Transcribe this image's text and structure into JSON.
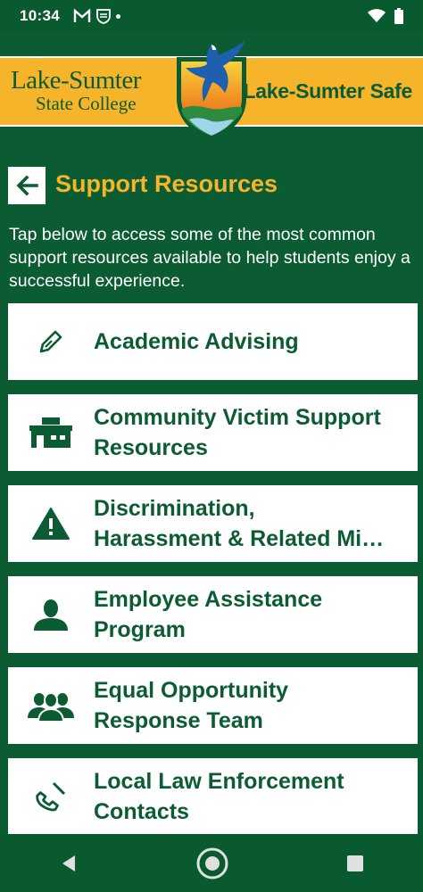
{
  "status_bar": {
    "time": "10:34"
  },
  "header": {
    "logo_line1": "Lake-Sumter",
    "logo_line2": "State College",
    "app_title": "Lake-Sumter Safe"
  },
  "page": {
    "title": "Support Resources",
    "intro": "Tap below to access some of the most common support resources available to help students enjoy a successful experience."
  },
  "resources": [
    {
      "label": "Academic Advising",
      "icon": "pen-icon"
    },
    {
      "label": "Community Victim Support\nResources",
      "icon": "building-icon"
    },
    {
      "label": "Discrimination,\nHarassment & Related Mi…",
      "icon": "warning-icon"
    },
    {
      "label": "Employee Assistance\nProgram",
      "icon": "person-icon"
    },
    {
      "label": "Equal Opportunity\nResponse Team",
      "icon": "group-icon"
    },
    {
      "label": "Local Law Enforcement\nContacts",
      "icon": "phone-icon"
    }
  ],
  "colors": {
    "brand_green": "#0b5c32",
    "brand_gold": "#f6b42a"
  }
}
